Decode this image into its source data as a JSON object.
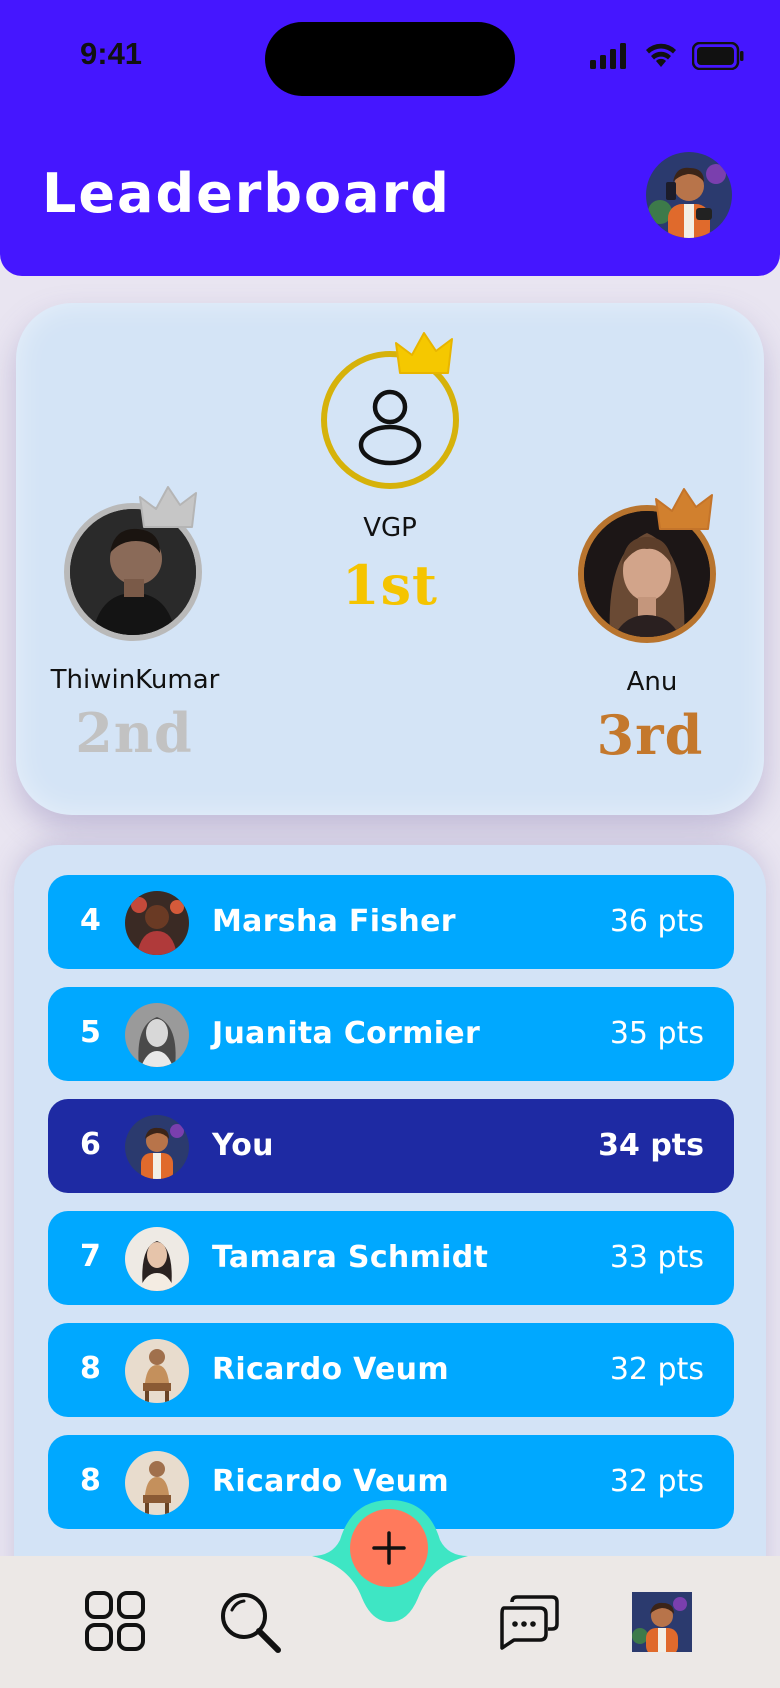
{
  "status_bar": {
    "time": "9:41"
  },
  "header": {
    "title": "Leaderboard"
  },
  "podium": {
    "first": {
      "name": "VGP",
      "rank": "1st"
    },
    "second": {
      "name": "ThiwinKumar",
      "rank": "2nd"
    },
    "third": {
      "name": "Anu",
      "rank": "3rd"
    }
  },
  "leaderboard": [
    {
      "rank": "4",
      "name": "Marsha Fisher",
      "points": "36 pts"
    },
    {
      "rank": "5",
      "name": "Juanita Cormier",
      "points": "35 pts"
    },
    {
      "rank": "6",
      "name": "You",
      "points": "34 pts"
    },
    {
      "rank": "7",
      "name": "Tamara Schmidt",
      "points": "33 pts"
    },
    {
      "rank": "8",
      "name": "Ricardo Veum",
      "points": "32 pts"
    },
    {
      "rank": "8",
      "name": "Ricardo Veum",
      "points": "32 pts"
    }
  ],
  "colors": {
    "header": "#4516ff",
    "row": "#00a8ff",
    "row_current_user": "#1e2aa3",
    "gold": "#f5c400",
    "silver": "#bdbdbd",
    "bronze": "#c47a2c",
    "fab": "#ff7a5c",
    "fab_bump": "#3ee6c4"
  },
  "icons": {
    "nav": [
      "grid-icon",
      "search-icon",
      "plus-icon",
      "chat-icon",
      "profile-avatar"
    ]
  }
}
